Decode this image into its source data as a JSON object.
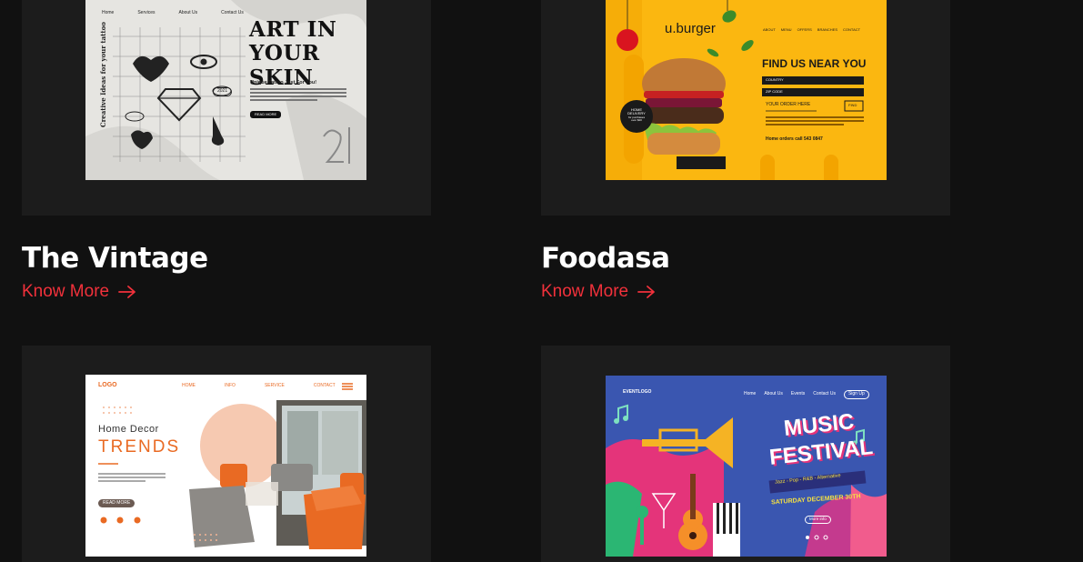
{
  "colors": {
    "page_bg": "#111111",
    "card_bg": "#1c1c1c",
    "accent": "#f2313b",
    "title": "#ffffff"
  },
  "projects": [
    {
      "title": "The Vintage",
      "link_label": "Know More",
      "link_icon": "arrow-right-icon",
      "preview": {
        "nav": [
          "Home",
          "Services",
          "About Us",
          "Contact Us"
        ],
        "side_text": "Creative Ideas for your tattoo",
        "headline": "ART IN YOUR SKIN",
        "subheadline": "Unique Tattoo Just For You!",
        "button": "READ MORE",
        "badge": "2021",
        "corner_number": "21"
      }
    },
    {
      "title": "Foodasa",
      "link_label": "Know More",
      "link_icon": "arrow-right-icon",
      "preview": {
        "logo": "u.burger",
        "nav": [
          "ABOUT",
          "MENU",
          "OFFERS",
          "BRANCHES",
          "CONTACT"
        ],
        "badge_line1": "HOME",
        "badge_line2": "DELIVERY",
        "badge_line3": "for purchases",
        "badge_line4": "over $20",
        "headline": "FIND US NEAR YOU",
        "country_label": "COUNTRY",
        "zip_label": "ZIP CODE",
        "order_link": "YOUR ORDER HERE",
        "find_button": "FIND",
        "phone": "Home orders call 543 0847"
      }
    },
    {
      "title": "",
      "preview": {
        "logo": "LOGO",
        "nav": [
          "HOME",
          "INFO",
          "SERVICE",
          "CONTACT"
        ],
        "kicker": "Home Decor",
        "headline": "TRENDS",
        "button": "READ MORE"
      }
    },
    {
      "title": "",
      "preview": {
        "logo": "EVENTLOGO",
        "nav": [
          "Home",
          "About Us",
          "Events",
          "Contact Us"
        ],
        "signup": "Sign Up",
        "headline1": "MUSIC",
        "headline2": "FESTIVAL",
        "genres": "Jazz - Pop - R&B - Alternative",
        "date": "SATURDAY DECEMBER 30TH",
        "more_button": "More info"
      }
    }
  ]
}
